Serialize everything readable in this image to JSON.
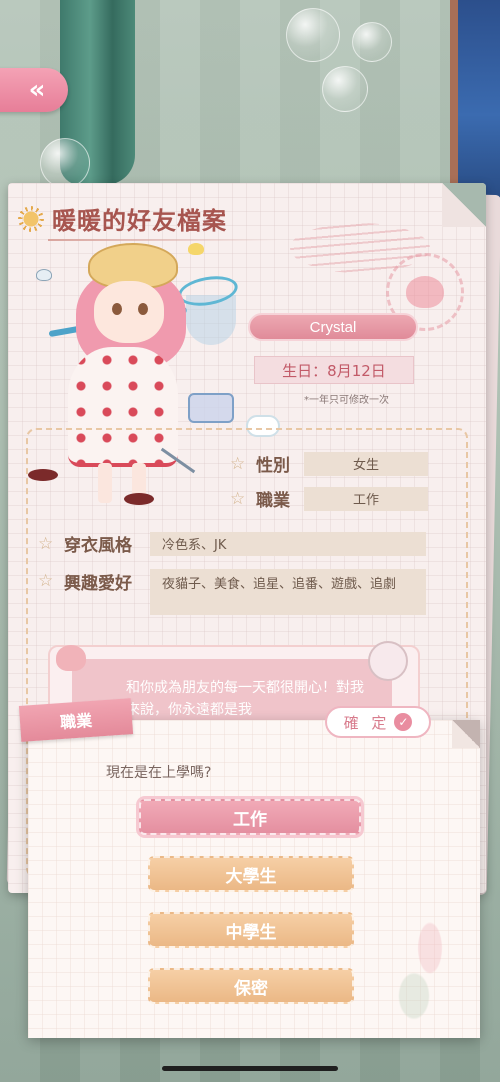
{
  "navigation": {
    "back_glyph": "«"
  },
  "profile_card": {
    "title": "暖暖的好友檔案",
    "name": "Crystal",
    "birthday": "生日：8月12日",
    "birthday_note": "*一年只可修改一次",
    "fields": {
      "gender": {
        "label": "性別",
        "value": "女生"
      },
      "occupation": {
        "label": "職業",
        "value": "工作"
      },
      "style": {
        "label": "穿衣風格",
        "value": "冷色系、JK"
      },
      "hobbies": {
        "label": "興趣愛好",
        "value": "夜貓子、美食、追星、追番、遊戲、追劇"
      }
    },
    "message": "和你成為朋友的每一天都很開心！對我來說，你永遠都是我"
  },
  "dialog": {
    "tag": "職業",
    "confirm_label": "確 定",
    "question": "現在是在上學嗎?",
    "options": [
      {
        "label": "工作",
        "selected": true
      },
      {
        "label": "大學生",
        "selected": false
      },
      {
        "label": "中學生",
        "selected": false
      },
      {
        "label": "保密",
        "selected": false
      }
    ]
  },
  "colors": {
    "accent_pink": "#e48fa0",
    "option_orange": "#ebb886",
    "title_red": "#a7554f"
  }
}
